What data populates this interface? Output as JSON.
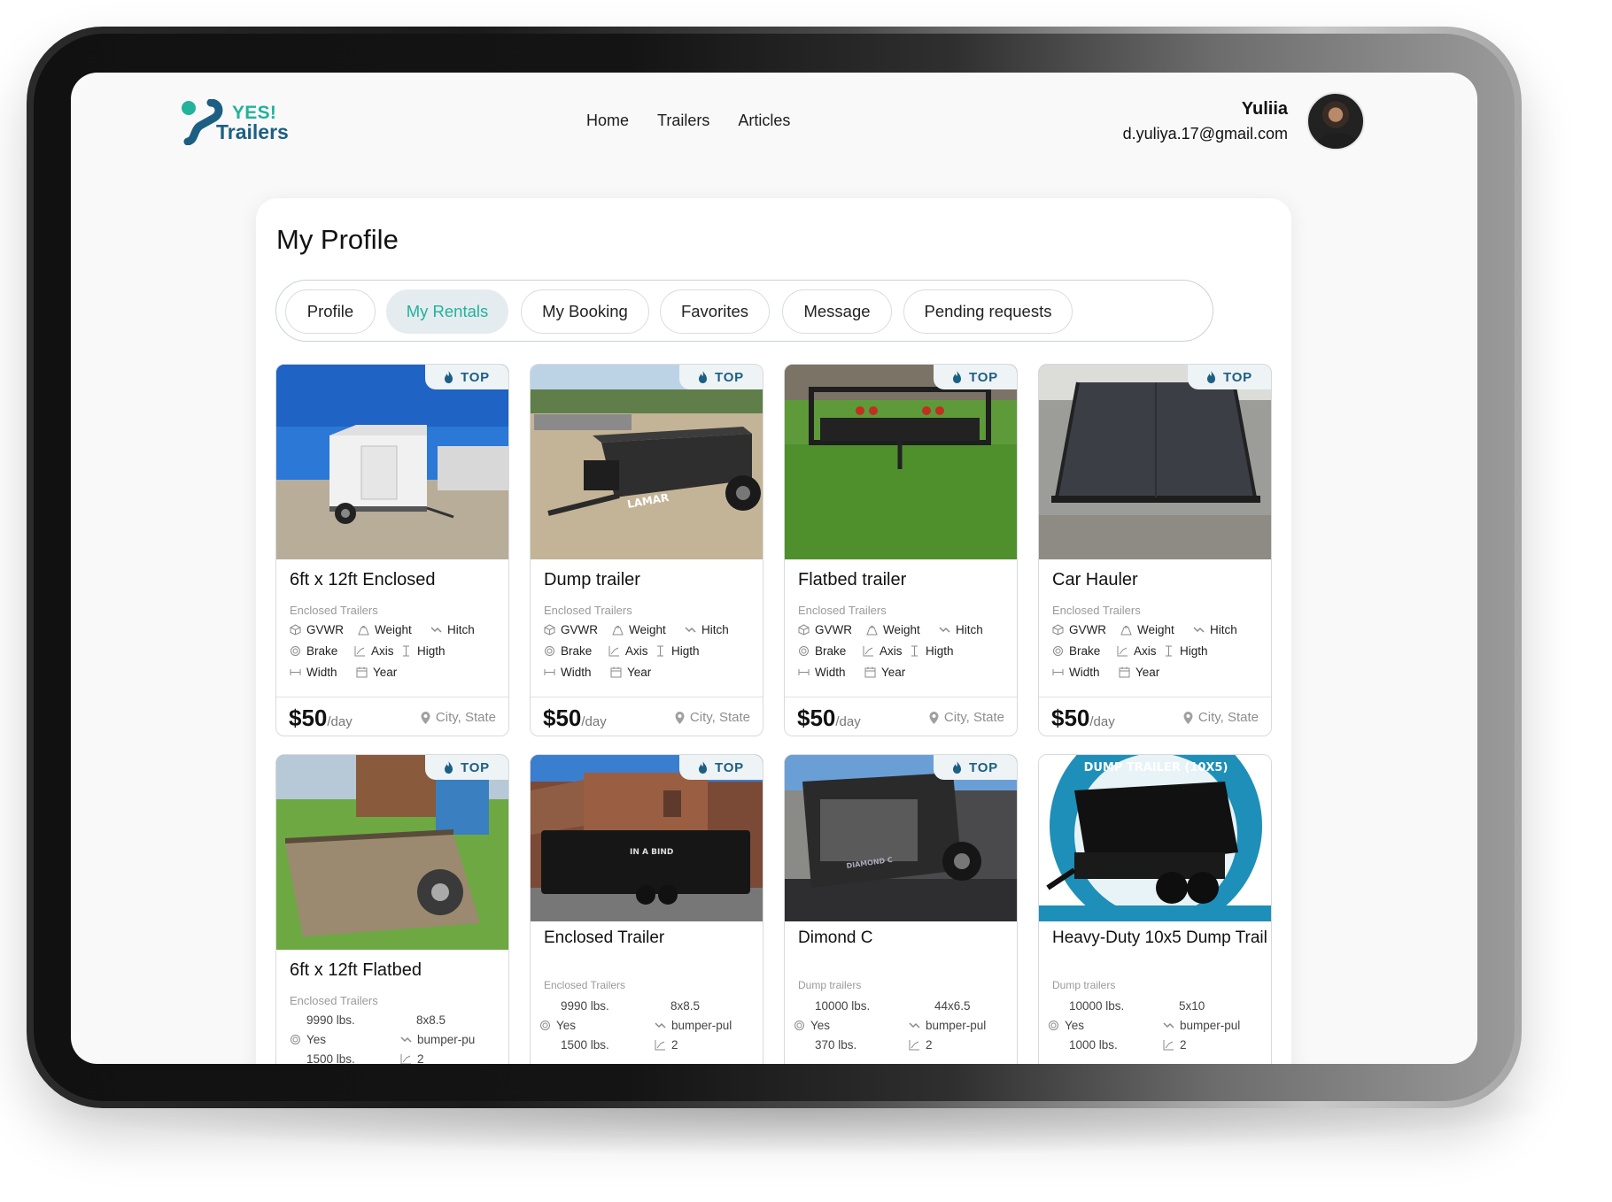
{
  "header": {
    "logo_yes": "YES!",
    "logo_trailers": "Trailers",
    "nav": [
      "Home",
      "Trailers",
      "Articles"
    ],
    "user_name": "Yuliia",
    "user_email": "d.yuliya.17@gmail.com"
  },
  "profile": {
    "title": "My Profile",
    "tabs": [
      "Profile",
      "My Rentals",
      "My Booking",
      "Favorites",
      "Message",
      "Pending requests"
    ],
    "active_tab": "My Rentals"
  },
  "colors": {
    "accent": "#23b29a",
    "brand_blue": "#1c5f83",
    "badge_bg": "#eef3f5",
    "tab_active_bg": "#e4ecf0"
  },
  "badge_label": "TOP",
  "cards_row1": [
    {
      "title": "6ft x 12ft Enclosed",
      "category": "Enclosed Trailers",
      "specs": [
        "GVWR",
        "Weight",
        "Hitch",
        "Brake",
        "Axis",
        "Higth",
        "Width",
        "Year"
      ],
      "price": "$50",
      "per": "/day",
      "location": "City, State",
      "top": true
    },
    {
      "title": "Dump trailer",
      "category": "Enclosed Trailers",
      "specs": [
        "GVWR",
        "Weight",
        "Hitch",
        "Brake",
        "Axis",
        "Higth",
        "Width",
        "Year"
      ],
      "price": "$50",
      "per": "/day",
      "location": "City, State",
      "top": true
    },
    {
      "title": "Flatbed trailer",
      "category": "Enclosed Trailers",
      "specs": [
        "GVWR",
        "Weight",
        "Hitch",
        "Brake",
        "Axis",
        "Higth",
        "Width",
        "Year"
      ],
      "price": "$50",
      "per": "/day",
      "location": "City, State",
      "top": true
    },
    {
      "title": "Car Hauler",
      "category": "Enclosed Trailers",
      "specs": [
        "GVWR",
        "Weight",
        "Hitch",
        "Brake",
        "Axis",
        "Higth",
        "Width",
        "Year"
      ],
      "price": "$50",
      "per": "/day",
      "location": "City, State",
      "top": true
    }
  ],
  "cards_row2": [
    {
      "title": "6ft x 12ft Flatbed",
      "category": "Enclosed Trailers",
      "values": [
        "9990 lbs.",
        "8x8.5",
        "Yes",
        "bumper-pu",
        "1500 lbs.",
        "2"
      ],
      "top": true
    },
    {
      "title": "Enclosed Trailer",
      "category": "Enclosed Trailers",
      "values": [
        "9990 lbs.",
        "8x8.5",
        "Yes",
        "bumper-pul",
        "1500 lbs.",
        "2"
      ],
      "top": true
    },
    {
      "title": "Dimond C",
      "category": "Dump trailers",
      "values": [
        "10000 lbs.",
        "44x6.5",
        "Yes",
        "bumper-pul",
        "370 lbs.",
        "2"
      ],
      "top": true
    },
    {
      "title": "Heavy-Duty 10x5 Dump Trail",
      "category": "Dump trailers",
      "values": [
        "10000 lbs.",
        "5x10",
        "Yes",
        "bumper-pul",
        "1000 lbs.",
        "2"
      ],
      "banner": "DUMP TRAILER (10X5)",
      "top": false
    }
  ]
}
